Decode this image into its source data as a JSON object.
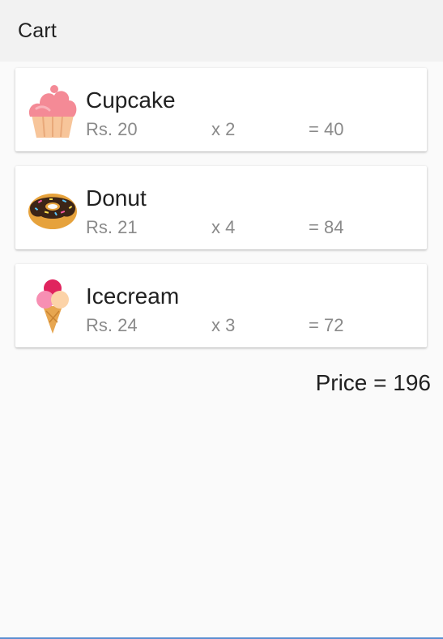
{
  "appbar": {
    "title": "Cart"
  },
  "cart": {
    "items": [
      {
        "name": "Cupcake",
        "price": "Rs. 20",
        "qty": "x 2",
        "total": "= 40",
        "icon": "cupcake-icon"
      },
      {
        "name": "Donut",
        "price": "Rs. 21",
        "qty": "x 4",
        "total": "= 84",
        "icon": "donut-icon"
      },
      {
        "name": "Icecream",
        "price": "Rs. 24",
        "qty": "x 3",
        "total": "= 72",
        "icon": "icecream-icon"
      }
    ],
    "total_label": "Price = 196"
  },
  "colors": {
    "appbar_bg": "#f2f2f2",
    "background": "#fafafa",
    "card_bg": "#ffffff",
    "primary_text": "#212121",
    "secondary_text": "#8a8a8a"
  }
}
